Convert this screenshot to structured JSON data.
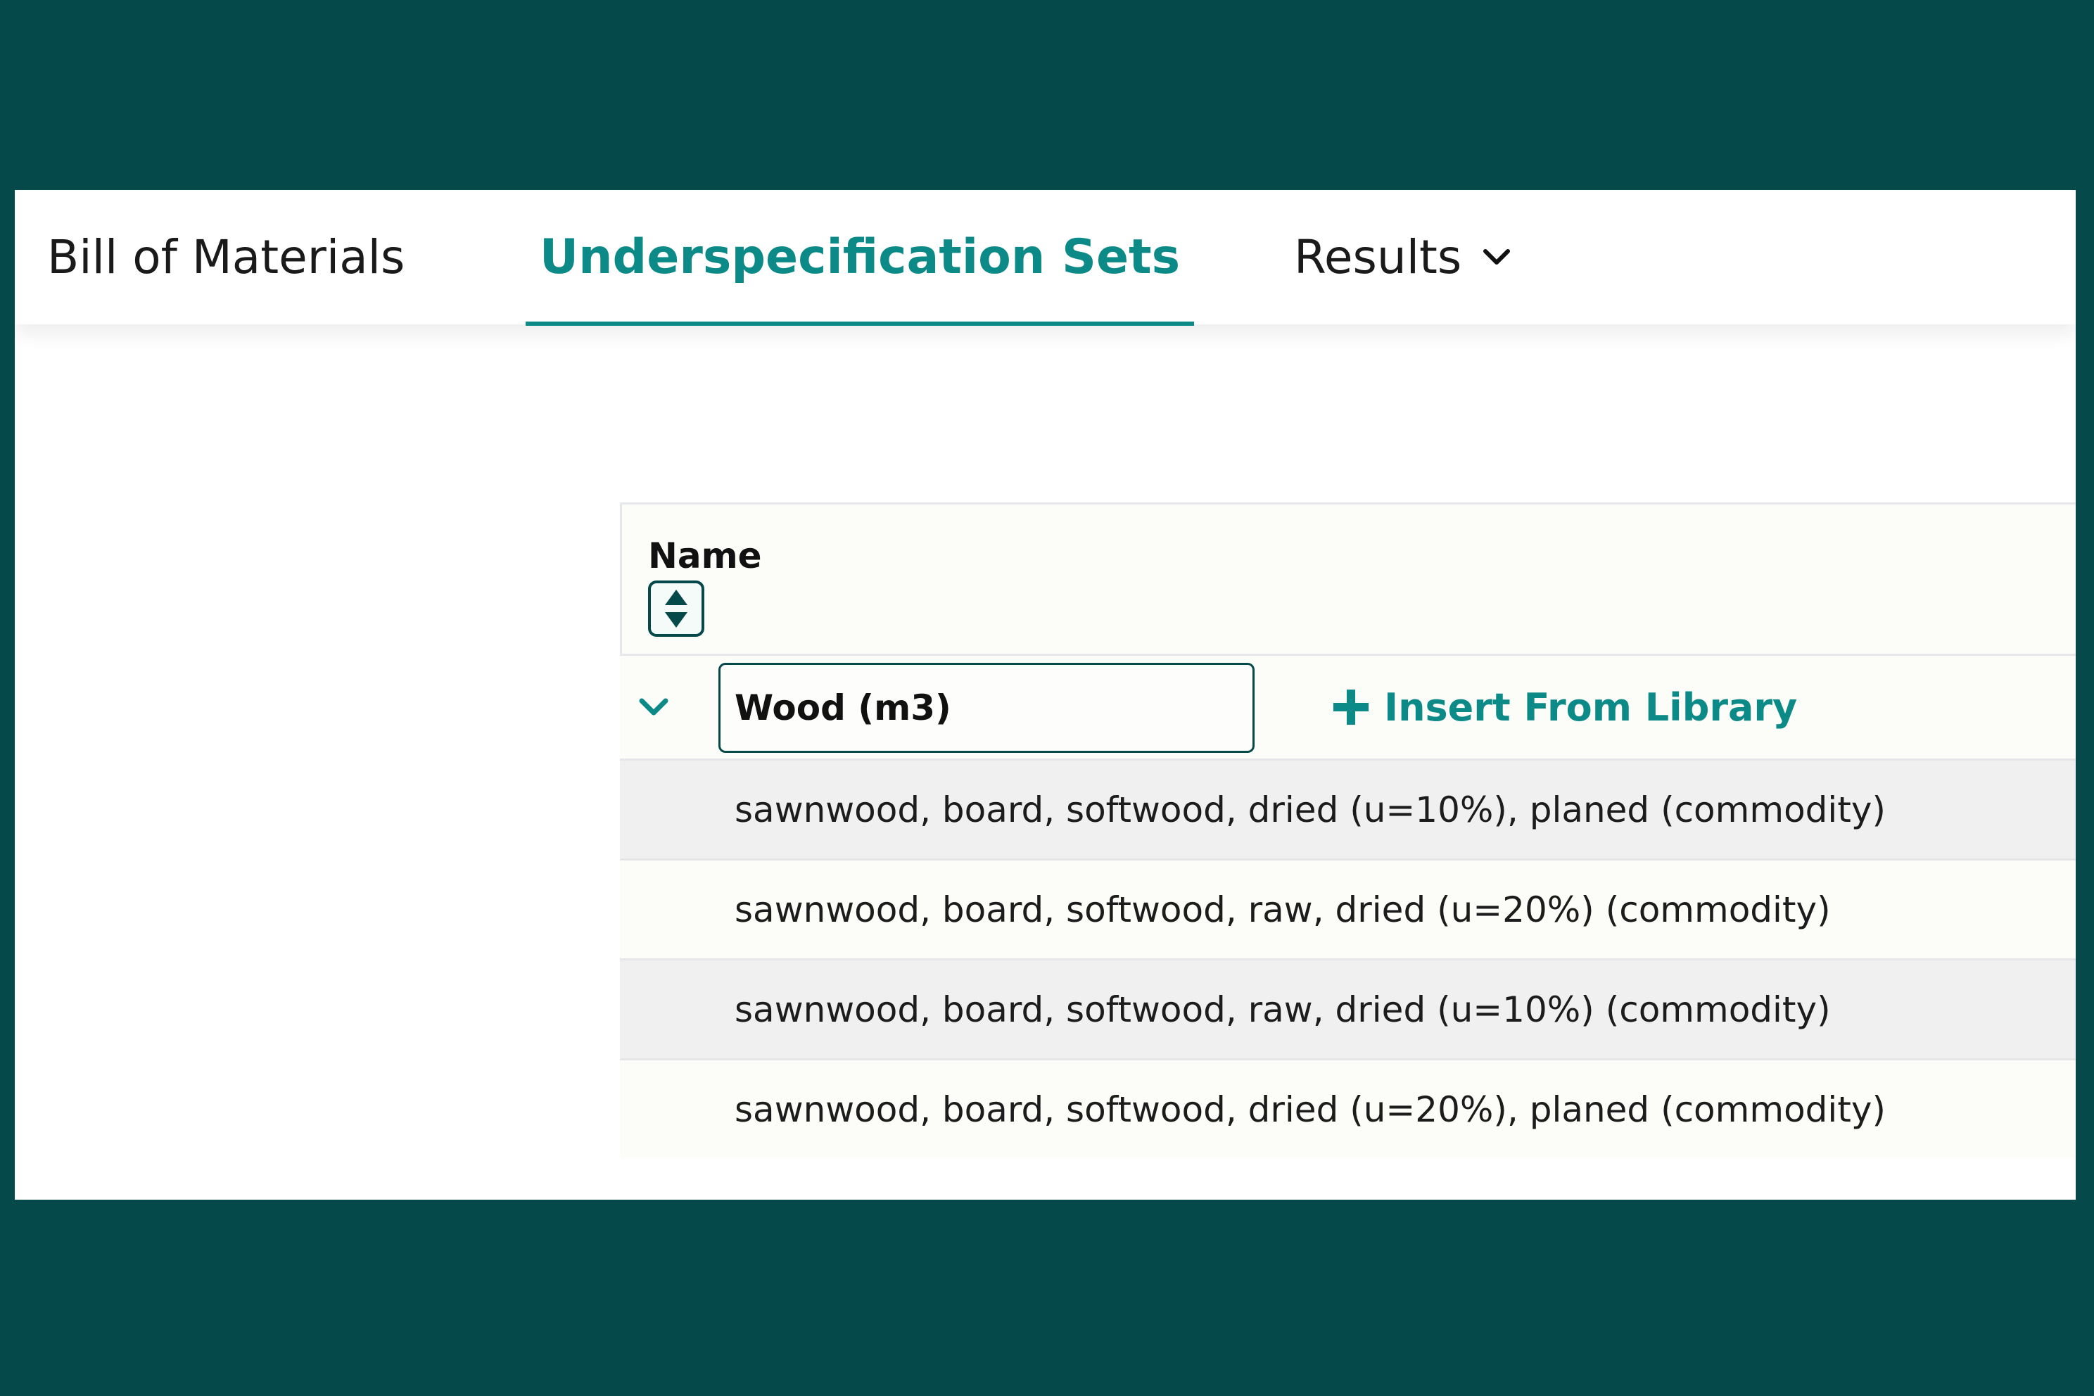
{
  "tabs": {
    "bill_of_materials": "Bill of Materials",
    "underspecification_sets": "Underspecification Sets",
    "results": "Results"
  },
  "active_tab": "Underspecification Sets",
  "table": {
    "header": {
      "name": "Name"
    },
    "group": {
      "name_value": "Wood (m3)",
      "insert_label": "Insert From Library",
      "expanded": true
    },
    "items": [
      "sawnwood, board, softwood, dried (u=10%), planed (commodity)",
      "sawnwood, board, softwood, raw, dried (u=20%) (commodity)",
      "sawnwood, board, softwood, raw, dried (u=10%) (commodity)",
      "sawnwood, board, softwood, dried (u=20%), planed (commodity)"
    ]
  },
  "icons": {
    "results_dropdown": "chevron-down-icon",
    "sort": "sort-icon",
    "expand": "chevron-down-icon",
    "insert": "plus-icon"
  },
  "colors": {
    "frame": "#05494b",
    "accent": "#0c8a88",
    "row_alt": "#f0f0f0"
  }
}
